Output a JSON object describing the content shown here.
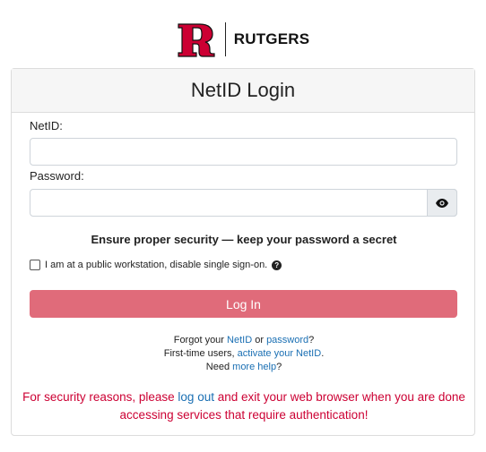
{
  "logo": {
    "text": "RUTGERS",
    "brand_color": "#cc0033"
  },
  "header": {
    "title": "NetID Login"
  },
  "form": {
    "netid_label": "NetID:",
    "netid_value": "",
    "password_label": "Password:",
    "password_value": "",
    "toggle_icon": "eye-icon",
    "security_note": "Ensure proper security — keep your password a secret",
    "public_checkbox_label": "I am at a public workstation, disable single sign-on.",
    "help_icon": "question-circle-icon",
    "login_button": "Log In",
    "login_button_color": "#e06b7a"
  },
  "links": {
    "forgot_prefix": "Forgot your ",
    "netid_link": "NetID",
    "or_text": " or ",
    "password_link": "password",
    "forgot_suffix": "?",
    "first_time_prefix": "First-time users, ",
    "activate_link": "activate your NetID",
    "first_time_suffix": ".",
    "need_prefix": "Need ",
    "more_help_link": "more help",
    "need_suffix": "?",
    "link_color": "#1a6fb3"
  },
  "warning": {
    "prefix": "For security reasons, please ",
    "logout_link": "log out",
    "suffix": " and exit your web browser when you are done accessing services that require authentication!",
    "color": "#cc0033"
  }
}
